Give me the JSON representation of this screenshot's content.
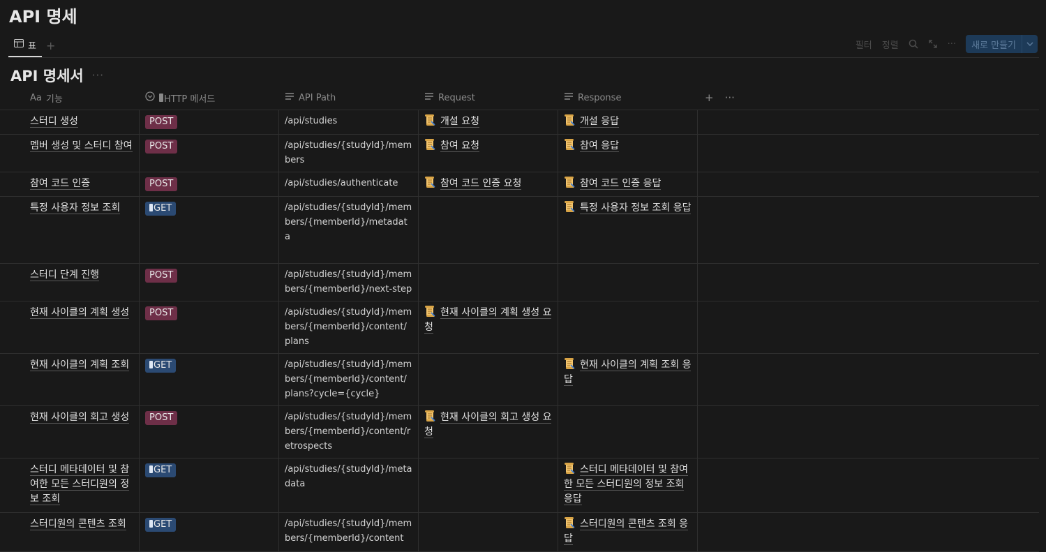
{
  "page": {
    "title": "API 명세"
  },
  "views": {
    "tab_label": "표",
    "add_label": "+"
  },
  "toolbar": {
    "filter": "필터",
    "sort": "정렬",
    "more": "···",
    "new_button": "새로 만들기"
  },
  "database": {
    "title": "API 명세서",
    "more": "···"
  },
  "columns": {
    "name": "기능",
    "method": "HTTP 메서드",
    "path": "API Path",
    "request": "Request",
    "response": "Response",
    "add": "+",
    "more": "···"
  },
  "colors": {
    "post": "#6e2f48",
    "get": "#2b4a73",
    "background": "#191919"
  },
  "rows": [
    {
      "name": "스터디 생성",
      "method": "POST",
      "path": "/api/studies",
      "request": "개설 요청",
      "response": "개설 응답"
    },
    {
      "name": "멤버 생성 및 스터디 참여",
      "method": "POST",
      "path": "/api/studies/{studyId}/members",
      "request": "참여 요청",
      "response": "참여 응답"
    },
    {
      "name": "참여 코드 인증",
      "method": "POST",
      "path": "/api/studies/authenticate",
      "request": "참여 코드 인증 요청",
      "response": "참여 코드 인증 응답"
    },
    {
      "name": "특정 사용자 정보 조회",
      "method": "GET",
      "path": "/api/studies/{studyId}/members/{memberId}/metadata",
      "request": "",
      "response": "특정 사용자 정보 조회 응답"
    },
    {
      "name": "스터디 단계 진행",
      "method": "POST",
      "path": "/api/studies/{studyId}/members/{memberId}/next-step",
      "request": "",
      "response": ""
    },
    {
      "name": "현재 사이클의 계획 생성",
      "method": "POST",
      "path": "/api/studies/{studyId}/members/{memberId}/content/plans",
      "request": "현재 사이클의 계획 생성 요청",
      "response": ""
    },
    {
      "name": "현재 사이클의 계획 조회",
      "method": "GET",
      "path": "/api/studies/{studyId}/members/{memberId}/content/plans?cycle={cycle}",
      "request": "",
      "response": "현재 사이클의 계획 조회 응답"
    },
    {
      "name": "현재 사이클의 회고 생성",
      "method": "POST",
      "path": "/api/studies/{studyId}/members/{memberId}/content/retrospects",
      "request": "현재 사이클의 회고 생성 요청",
      "response": ""
    },
    {
      "name": "스터디 메타데이터 및 참여한 모든 스터디원의 정보 조회",
      "method": "GET",
      "path": "/api/studies/{studyId}/metadata",
      "request": "",
      "response": "스터디 메타데이터 및 참여한 모든 스터디원의 정보 조회 응답"
    },
    {
      "name": "스터디원의 콘텐츠 조회",
      "method": "GET",
      "path": "/api/studies/{studyId}/members/{memberId}/content",
      "request": "",
      "response": "스터디원의 콘텐츠 조회 응답"
    }
  ]
}
